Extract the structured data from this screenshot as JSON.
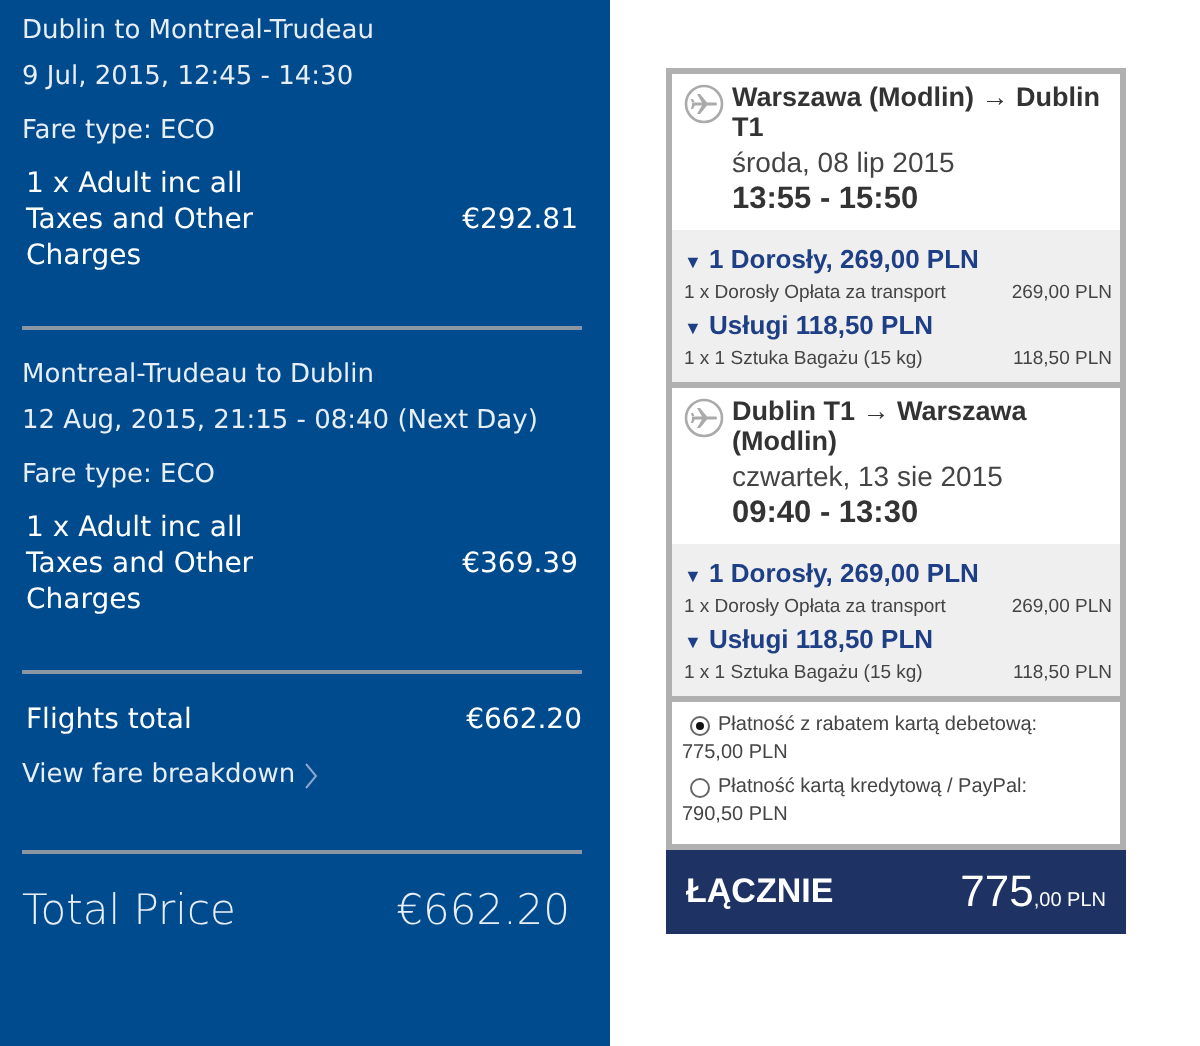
{
  "summary": {
    "flights": [
      {
        "route": "Dublin to Montreal-Trudeau",
        "dates": "9 Jul, 2015, 12:45 - 14:30",
        "fare_type": "Fare type: ECO",
        "line_label": "1 x Adult inc all Taxes and Other Charges",
        "line_price": "€292.81"
      },
      {
        "route": "Montreal-Trudeau to Dublin",
        "dates": "12 Aug, 2015, 21:15 - 08:40 (Next Day)",
        "fare_type": "Fare type: ECO",
        "line_label": "1 x Adult inc all Taxes and Other Charges",
        "line_price": "€369.39"
      }
    ],
    "flights_total_label": "Flights total",
    "flights_total": "€662.20",
    "breakdown_link": "View fare breakdown",
    "total_label": "Total Price",
    "total": "€662.20"
  },
  "booking": {
    "segments": [
      {
        "route": "Warszawa (Modlin) → Dublin T1",
        "date": "środa, 08 lip 2015",
        "times": "13:55 - 15:50",
        "groups": [
          {
            "toggle": "▼",
            "title": "1 Dorosły, 269,00 PLN",
            "expanded": true,
            "item": "1 x Dorosły Opłata za transport",
            "item_price": "269,00 PLN"
          },
          {
            "toggle": "▼",
            "title": "Usługi  118,50 PLN",
            "expanded": true,
            "item": "1 x 1 Sztuka Bagażu (15 kg)",
            "item_price": "118,50 PLN"
          }
        ]
      },
      {
        "route": "Dublin T1 → Warszawa (Modlin)",
        "date": "czwartek, 13 sie 2015",
        "times": "09:40 - 13:30",
        "groups": [
          {
            "toggle": "▼",
            "title": "1 Dorosły, 269,00 PLN",
            "expanded": true,
            "item": "1 x Dorosły Opłata za transport",
            "item_price": "269,00 PLN"
          },
          {
            "toggle": "▼",
            "title": "Usługi  118,50 PLN",
            "expanded": true,
            "item": "1 x 1 Sztuka Bagażu (15 kg)",
            "item_price": "118,50 PLN"
          }
        ]
      }
    ],
    "payments": [
      {
        "label": "Płatność z rabatem kartą debetową:",
        "amount": "775,00 PLN",
        "selected": true
      },
      {
        "label": "Płatność kartą kredytową / PayPal:",
        "amount": "790,50 PLN",
        "selected": false
      }
    ],
    "total_label": "ŁĄCZNIE",
    "total_main": "775",
    "total_rest": ",00 PLN"
  }
}
